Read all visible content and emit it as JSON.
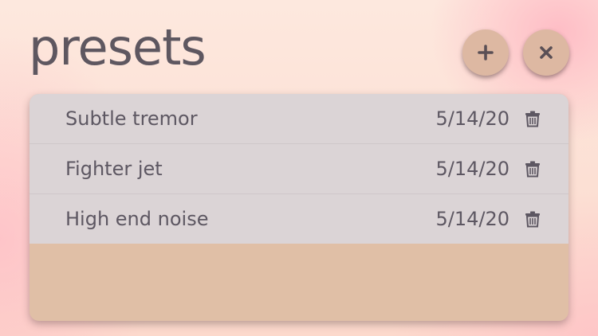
{
  "header": {
    "title": "presets"
  },
  "actions": {
    "add_icon": "plus-icon",
    "close_icon": "close-icon"
  },
  "presets": [
    {
      "name": "Subtle tremor",
      "date": "5/14/20",
      "icon": "trash-icon"
    },
    {
      "name": "Fighter jet",
      "date": "5/14/20",
      "icon": "trash-icon"
    },
    {
      "name": "High end noise",
      "date": "5/14/20",
      "icon": "trash-icon"
    }
  ],
  "colors": {
    "text": "#5d5762",
    "row_bg": "#dbd4d6",
    "panel_bg": "#e0bfa6",
    "button_bg": "#ddb8a2"
  }
}
